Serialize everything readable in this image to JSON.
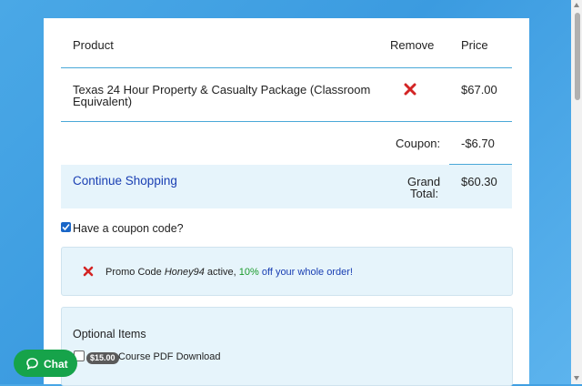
{
  "cart": {
    "headers": {
      "product": "Product",
      "remove": "Remove",
      "price": "Price"
    },
    "items": [
      {
        "name_line1": "Texas 24 Hour Property & Casualty Package (Classroom",
        "name_line2": "Equivalent)",
        "price": "$67.00",
        "remove_icon": "close-x-icon"
      }
    ],
    "coupon_label": "Coupon:",
    "coupon_value": "-$6.70",
    "continue_label": "Continue Shopping",
    "grand_label_line1": "Grand",
    "grand_label_line2": "Total:",
    "grand_value": "$60.30"
  },
  "coupon_toggle": {
    "label": "Have a coupon code?",
    "checked": true
  },
  "promo": {
    "prefix": "Promo Code ",
    "code": "Honey94",
    "middle": " active, ",
    "percent": "10%",
    "suffix": " off your whole order!"
  },
  "optional_items": {
    "title": "Optional Items",
    "items": [
      {
        "price": "$15.00",
        "label": "Course PDF Download",
        "checked": false
      }
    ]
  },
  "chat": {
    "label": "Chat"
  },
  "colors": {
    "accent_blue": "#1a3fb3",
    "remove_red": "#d32424",
    "chat_green": "#16a34a",
    "highlight_bg": "#e6f4fb"
  }
}
